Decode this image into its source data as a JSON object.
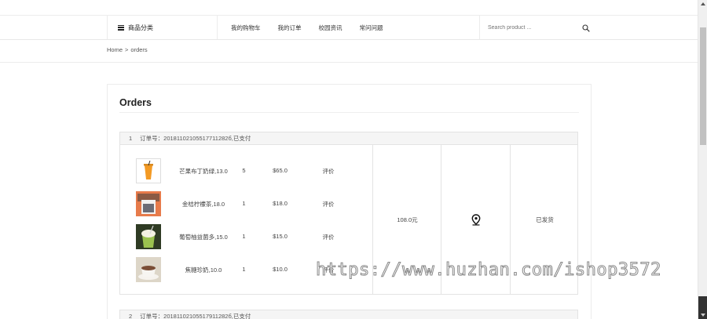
{
  "nav": {
    "category_label": "商品分类",
    "menu": [
      "我的购物车",
      "我的订单",
      "校园资讯",
      "常问问题"
    ],
    "search_placeholder": "Search product ..."
  },
  "breadcrumb": {
    "home": "Home",
    "separator": ">",
    "current": "orders"
  },
  "page_title": "Orders",
  "orders": [
    {
      "num": "1",
      "header": "订单号：20181102105517711282б,已支付",
      "items": [
        {
          "name": "芒果布丁奶绿,13.0",
          "qty": "5",
          "price": "$65.0",
          "review": "评价"
        },
        {
          "name": "金桔柠檬茶,18.0",
          "qty": "1",
          "price": "$18.0",
          "review": "评价"
        },
        {
          "name": "葡萄柚益菌多,15.0",
          "qty": "1",
          "price": "$15.0",
          "review": "评价"
        },
        {
          "name": "焦糖珍奶,10.0",
          "qty": "1",
          "price": "$10.0",
          "review": "评价"
        }
      ],
      "total": "108.0元",
      "status": "已发货"
    },
    {
      "num": "2",
      "header": "订单号：20181102105517911282б,已支付"
    }
  ],
  "watermark": "https://www.huzhan.com/ishop3572",
  "icons": {
    "menu": "hamburger-icon",
    "search": "search-icon",
    "location": "location-pin-icon"
  }
}
